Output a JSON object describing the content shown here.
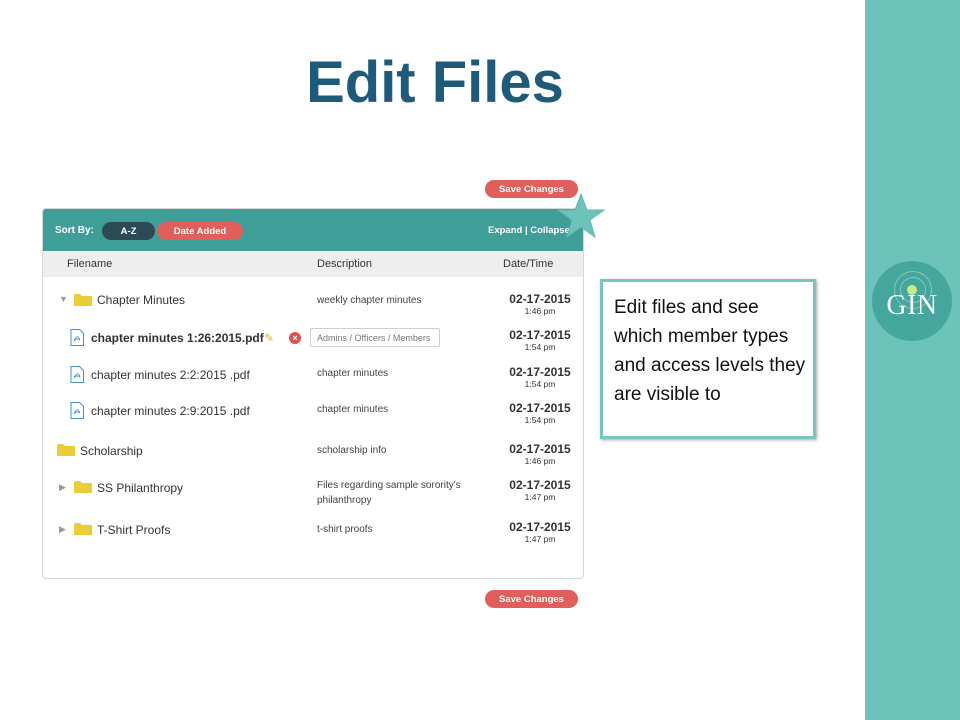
{
  "slide": {
    "title": "Edit Files",
    "callout_text": "Edit files and see which member types and access levels they are visible to"
  },
  "logo": {
    "text": "GIN"
  },
  "save_label": "Save Changes",
  "toolbar": {
    "sort_label": "Sort By:",
    "sort_az": "A-Z",
    "sort_date": "Date Added",
    "expand": "Expand",
    "separator": " | ",
    "collapse": "Collapse"
  },
  "table": {
    "headers": {
      "filename": "Filename",
      "description": "Description",
      "datetime": "Date/Time"
    },
    "rows": [
      {
        "name": "Chapter Minutes",
        "description": "weekly chapter minutes",
        "date": "02-17-2015",
        "time": "1:46 pm"
      },
      {
        "name": "chapter minutes 1:26:2015.pdf",
        "description": "Admins / Officers / Members",
        "date": "02-17-2015",
        "time": "1:54 pm"
      },
      {
        "name": "chapter minutes 2:2:2015 .pdf",
        "description": "chapter minutes",
        "date": "02-17-2015",
        "time": "1:54 pm"
      },
      {
        "name": "chapter minutes 2:9:2015 .pdf",
        "description": "chapter minutes",
        "date": "02-17-2015",
        "time": "1:54 pm"
      },
      {
        "name": "Scholarship",
        "description": "scholarship info",
        "date": "02-17-2015",
        "time": "1:46 pm"
      },
      {
        "name": "SS Philanthropy",
        "description": "Files regarding sample sorority's philanthropy",
        "date": "02-17-2015",
        "time": "1:47 pm"
      },
      {
        "name": "T-Shirt Proofs",
        "description": "t-shirt proofs",
        "date": "02-17-2015",
        "time": "1:47 pm"
      }
    ]
  },
  "colors": {
    "teal": "#3f9e97",
    "band": "#6cc3ba",
    "coral": "#e05f5c",
    "title": "#1e5b7a",
    "folder": "#e8cf3a",
    "pdf": "#4a8fd1"
  },
  "icons": [
    "caret-down-icon",
    "caret-right-icon",
    "folder-icon",
    "pdf-file-icon",
    "pencil-icon",
    "delete-icon",
    "star-icon"
  ]
}
